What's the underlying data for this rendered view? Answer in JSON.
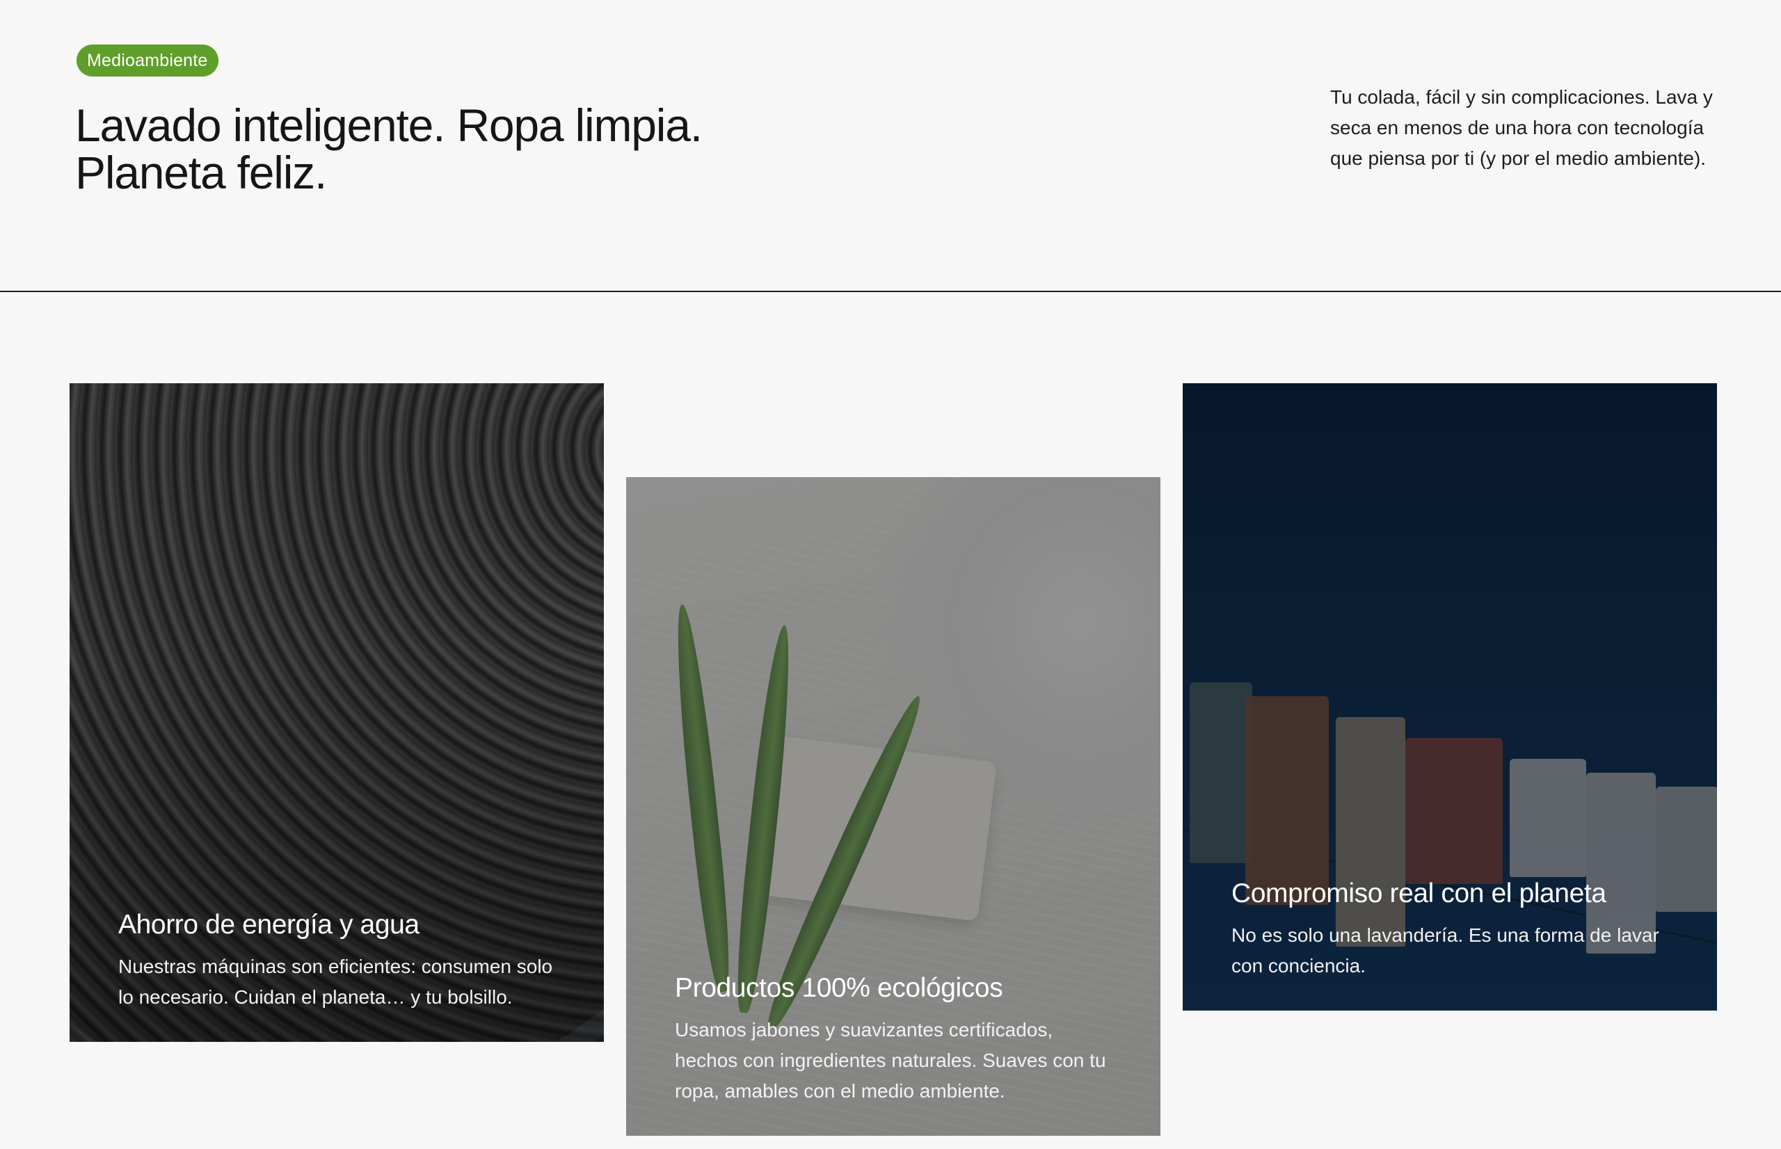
{
  "hero": {
    "tag": "Medioambiente",
    "headline_line1": "Lavado inteligente. Ropa limpia.",
    "headline_line2": "Planeta feliz.",
    "intro": "Tu colada, fácil y sin complicaciones. Lava y seca en menos de una hora con tecnología que piensa por ti (y por el medio ambiente)."
  },
  "colors": {
    "tag_background": "#5f9e2b",
    "page_background": "#f7f7f7",
    "text_primary": "#161616"
  },
  "cards": [
    {
      "title": "Ahorro de energía y agua",
      "text": "Nuestras máquinas son eficientes: consumen solo lo necesario. Cuidan el planeta… y tu bolsillo.",
      "image": "washing-machine-drum-image"
    },
    {
      "title": "Productos 100% ecológicos",
      "text": "Usamos jabones y suavizantes certificados, hechos con ingredientes naturales. Suaves con tu ropa, amables con el medio ambiente.",
      "image": "eco-soap-with-leaves-image"
    },
    {
      "title": "Compromiso real con el planeta",
      "text": "No es solo una lavandería. Es una forma de lavar con conciencia.",
      "image": "clothesline-under-sky-image"
    }
  ]
}
